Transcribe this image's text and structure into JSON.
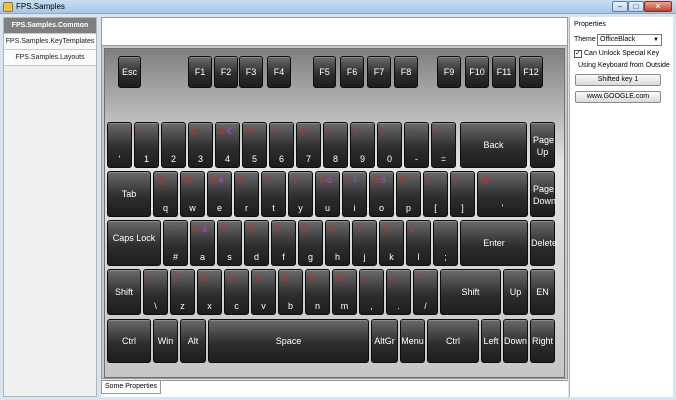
{
  "window": {
    "title": "FPS.Samples",
    "min_label": "–",
    "max_label": "□",
    "close_label": "✕"
  },
  "sidebar": {
    "items": [
      {
        "label": "FPS.Samples.Common"
      },
      {
        "label": "FPS.Samples.KeyTemplates"
      },
      {
        "label": "FPS.Samples.Layouts"
      }
    ]
  },
  "keyboard": {
    "fkeys": [
      {
        "label": "Esc"
      },
      {
        "label": "F1"
      },
      {
        "label": "F2"
      },
      {
        "label": "F3"
      },
      {
        "label": "F4"
      },
      {
        "label": "F5"
      },
      {
        "label": "F6"
      },
      {
        "label": "F7"
      },
      {
        "label": "F8"
      },
      {
        "label": "F9"
      },
      {
        "label": "F10"
      },
      {
        "label": "F11"
      },
      {
        "label": "F12"
      }
    ],
    "row1": [
      {
        "sh": "\"",
        "main": "'"
      },
      {
        "sh": "!",
        "main": "1"
      },
      {
        "sh": "\"",
        "main": "2"
      },
      {
        "sh": "£",
        "main": "3"
      },
      {
        "sh": "$",
        "alt": "€",
        "main": "4"
      },
      {
        "sh": "%",
        "main": "5"
      },
      {
        "sh": "^",
        "main": "6"
      },
      {
        "sh": "&",
        "main": "7"
      },
      {
        "sh": "*",
        "main": "8"
      },
      {
        "sh": "(",
        "main": "9"
      },
      {
        "sh": ")",
        "main": "0"
      },
      {
        "sh": "_",
        "main": "-"
      },
      {
        "sh": "+",
        "main": "="
      },
      {
        "label": "Back"
      },
      {
        "label": "Page Up"
      }
    ],
    "row2": [
      {
        "label": "Tab"
      },
      {
        "sh": "Q",
        "main": "q"
      },
      {
        "sh": "W",
        "main": "w"
      },
      {
        "sh": "E",
        "alt": "é",
        "main": "e"
      },
      {
        "sh": "R",
        "main": "r"
      },
      {
        "sh": "T",
        "main": "t"
      },
      {
        "sh": "Y",
        "main": "y"
      },
      {
        "sh": "U",
        "alt": "ú",
        "main": "u"
      },
      {
        "sh": "I",
        "alt": "í",
        "main": "i"
      },
      {
        "sh": "O",
        "alt": "ó",
        "main": "o"
      },
      {
        "sh": "P",
        "main": "p"
      },
      {
        "sh": "{",
        "main": "["
      },
      {
        "sh": "}",
        "main": "]"
      },
      {
        "sh": "@",
        "main": "'"
      },
      {
        "label": "Page Down"
      }
    ],
    "row3": [
      {
        "label": "Caps Lock"
      },
      {
        "sh": "~",
        "main": "#"
      },
      {
        "sh": "A",
        "alt": "á",
        "main": "a"
      },
      {
        "sh": "S",
        "main": "s"
      },
      {
        "sh": "D",
        "main": "d"
      },
      {
        "sh": "F",
        "main": "f"
      },
      {
        "sh": "G",
        "main": "g"
      },
      {
        "sh": "H",
        "main": "h"
      },
      {
        "sh": "J",
        "main": "j"
      },
      {
        "sh": "K",
        "main": "k"
      },
      {
        "sh": "L",
        "main": "l"
      },
      {
        "sh": ":",
        "main": ";"
      },
      {
        "label": "Enter"
      },
      {
        "label": "Delete"
      }
    ],
    "row4": [
      {
        "label": "Shift"
      },
      {
        "sh": "|",
        "main": "\\"
      },
      {
        "sh": "Z",
        "main": "z"
      },
      {
        "sh": "X",
        "main": "x"
      },
      {
        "sh": "C",
        "main": "c"
      },
      {
        "sh": "V",
        "main": "v"
      },
      {
        "sh": "B",
        "main": "b"
      },
      {
        "sh": "N",
        "main": "n"
      },
      {
        "sh": "M",
        "main": "m"
      },
      {
        "sh": "<",
        "main": ","
      },
      {
        "sh": ">",
        "main": "."
      },
      {
        "sh": "?",
        "main": "/"
      },
      {
        "label": "Shift"
      },
      {
        "label": "Up"
      },
      {
        "label": "EN"
      }
    ],
    "row5": [
      {
        "label": "Ctrl"
      },
      {
        "label": "Win"
      },
      {
        "label": "Alt"
      },
      {
        "label": "Space"
      },
      {
        "label": "AltGr"
      },
      {
        "label": "Menu"
      },
      {
        "label": "Ctrl"
      },
      {
        "label": "Left"
      },
      {
        "label": "Down"
      },
      {
        "label": "Right"
      }
    ]
  },
  "bottom_tabs": [
    {
      "label": "Some Properties"
    }
  ],
  "properties": {
    "title": "Properties",
    "theme_label": "Theme",
    "theme_value": "OfficeBlack",
    "unlock_checked": true,
    "unlock_label": "Can Unlock Special Key",
    "group_title": "Using Keyboard from Outside",
    "shifted_button": "Shifted key 1",
    "google_button": "www.GOOGLE.com"
  }
}
